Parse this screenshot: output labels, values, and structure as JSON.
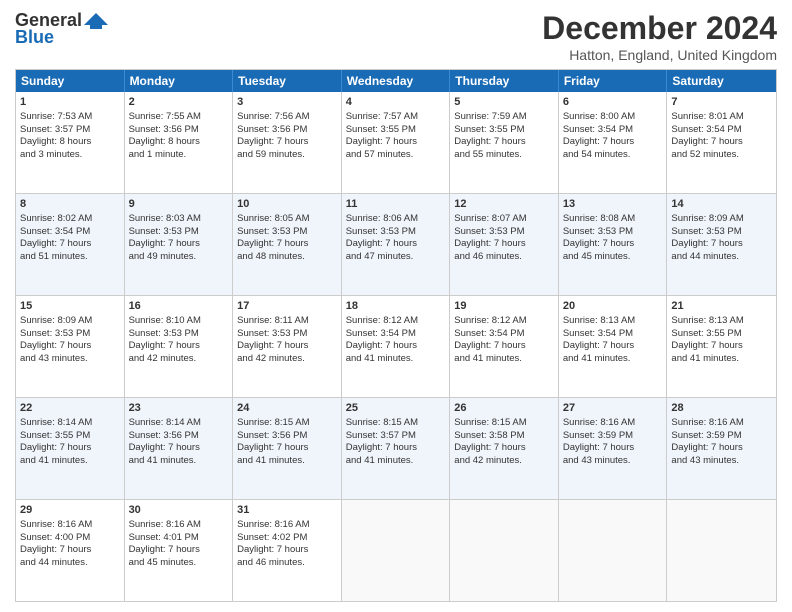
{
  "logo": {
    "line1": "General",
    "line2": "Blue"
  },
  "title": "December 2024",
  "location": "Hatton, England, United Kingdom",
  "header_days": [
    "Sunday",
    "Monday",
    "Tuesday",
    "Wednesday",
    "Thursday",
    "Friday",
    "Saturday"
  ],
  "weeks": [
    [
      {
        "day": "1",
        "lines": [
          "Sunrise: 7:53 AM",
          "Sunset: 3:57 PM",
          "Daylight: 8 hours",
          "and 3 minutes."
        ]
      },
      {
        "day": "2",
        "lines": [
          "Sunrise: 7:55 AM",
          "Sunset: 3:56 PM",
          "Daylight: 8 hours",
          "and 1 minute."
        ]
      },
      {
        "day": "3",
        "lines": [
          "Sunrise: 7:56 AM",
          "Sunset: 3:56 PM",
          "Daylight: 7 hours",
          "and 59 minutes."
        ]
      },
      {
        "day": "4",
        "lines": [
          "Sunrise: 7:57 AM",
          "Sunset: 3:55 PM",
          "Daylight: 7 hours",
          "and 57 minutes."
        ]
      },
      {
        "day": "5",
        "lines": [
          "Sunrise: 7:59 AM",
          "Sunset: 3:55 PM",
          "Daylight: 7 hours",
          "and 55 minutes."
        ]
      },
      {
        "day": "6",
        "lines": [
          "Sunrise: 8:00 AM",
          "Sunset: 3:54 PM",
          "Daylight: 7 hours",
          "and 54 minutes."
        ]
      },
      {
        "day": "7",
        "lines": [
          "Sunrise: 8:01 AM",
          "Sunset: 3:54 PM",
          "Daylight: 7 hours",
          "and 52 minutes."
        ]
      }
    ],
    [
      {
        "day": "8",
        "lines": [
          "Sunrise: 8:02 AM",
          "Sunset: 3:54 PM",
          "Daylight: 7 hours",
          "and 51 minutes."
        ]
      },
      {
        "day": "9",
        "lines": [
          "Sunrise: 8:03 AM",
          "Sunset: 3:53 PM",
          "Daylight: 7 hours",
          "and 49 minutes."
        ]
      },
      {
        "day": "10",
        "lines": [
          "Sunrise: 8:05 AM",
          "Sunset: 3:53 PM",
          "Daylight: 7 hours",
          "and 48 minutes."
        ]
      },
      {
        "day": "11",
        "lines": [
          "Sunrise: 8:06 AM",
          "Sunset: 3:53 PM",
          "Daylight: 7 hours",
          "and 47 minutes."
        ]
      },
      {
        "day": "12",
        "lines": [
          "Sunrise: 8:07 AM",
          "Sunset: 3:53 PM",
          "Daylight: 7 hours",
          "and 46 minutes."
        ]
      },
      {
        "day": "13",
        "lines": [
          "Sunrise: 8:08 AM",
          "Sunset: 3:53 PM",
          "Daylight: 7 hours",
          "and 45 minutes."
        ]
      },
      {
        "day": "14",
        "lines": [
          "Sunrise: 8:09 AM",
          "Sunset: 3:53 PM",
          "Daylight: 7 hours",
          "and 44 minutes."
        ]
      }
    ],
    [
      {
        "day": "15",
        "lines": [
          "Sunrise: 8:09 AM",
          "Sunset: 3:53 PM",
          "Daylight: 7 hours",
          "and 43 minutes."
        ]
      },
      {
        "day": "16",
        "lines": [
          "Sunrise: 8:10 AM",
          "Sunset: 3:53 PM",
          "Daylight: 7 hours",
          "and 42 minutes."
        ]
      },
      {
        "day": "17",
        "lines": [
          "Sunrise: 8:11 AM",
          "Sunset: 3:53 PM",
          "Daylight: 7 hours",
          "and 42 minutes."
        ]
      },
      {
        "day": "18",
        "lines": [
          "Sunrise: 8:12 AM",
          "Sunset: 3:54 PM",
          "Daylight: 7 hours",
          "and 41 minutes."
        ]
      },
      {
        "day": "19",
        "lines": [
          "Sunrise: 8:12 AM",
          "Sunset: 3:54 PM",
          "Daylight: 7 hours",
          "and 41 minutes."
        ]
      },
      {
        "day": "20",
        "lines": [
          "Sunrise: 8:13 AM",
          "Sunset: 3:54 PM",
          "Daylight: 7 hours",
          "and 41 minutes."
        ]
      },
      {
        "day": "21",
        "lines": [
          "Sunrise: 8:13 AM",
          "Sunset: 3:55 PM",
          "Daylight: 7 hours",
          "and 41 minutes."
        ]
      }
    ],
    [
      {
        "day": "22",
        "lines": [
          "Sunrise: 8:14 AM",
          "Sunset: 3:55 PM",
          "Daylight: 7 hours",
          "and 41 minutes."
        ]
      },
      {
        "day": "23",
        "lines": [
          "Sunrise: 8:14 AM",
          "Sunset: 3:56 PM",
          "Daylight: 7 hours",
          "and 41 minutes."
        ]
      },
      {
        "day": "24",
        "lines": [
          "Sunrise: 8:15 AM",
          "Sunset: 3:56 PM",
          "Daylight: 7 hours",
          "and 41 minutes."
        ]
      },
      {
        "day": "25",
        "lines": [
          "Sunrise: 8:15 AM",
          "Sunset: 3:57 PM",
          "Daylight: 7 hours",
          "and 41 minutes."
        ]
      },
      {
        "day": "26",
        "lines": [
          "Sunrise: 8:15 AM",
          "Sunset: 3:58 PM",
          "Daylight: 7 hours",
          "and 42 minutes."
        ]
      },
      {
        "day": "27",
        "lines": [
          "Sunrise: 8:16 AM",
          "Sunset: 3:59 PM",
          "Daylight: 7 hours",
          "and 43 minutes."
        ]
      },
      {
        "day": "28",
        "lines": [
          "Sunrise: 8:16 AM",
          "Sunset: 3:59 PM",
          "Daylight: 7 hours",
          "and 43 minutes."
        ]
      }
    ],
    [
      {
        "day": "29",
        "lines": [
          "Sunrise: 8:16 AM",
          "Sunset: 4:00 PM",
          "Daylight: 7 hours",
          "and 44 minutes."
        ]
      },
      {
        "day": "30",
        "lines": [
          "Sunrise: 8:16 AM",
          "Sunset: 4:01 PM",
          "Daylight: 7 hours",
          "and 45 minutes."
        ]
      },
      {
        "day": "31",
        "lines": [
          "Sunrise: 8:16 AM",
          "Sunset: 4:02 PM",
          "Daylight: 7 hours",
          "and 46 minutes."
        ]
      },
      null,
      null,
      null,
      null
    ]
  ]
}
